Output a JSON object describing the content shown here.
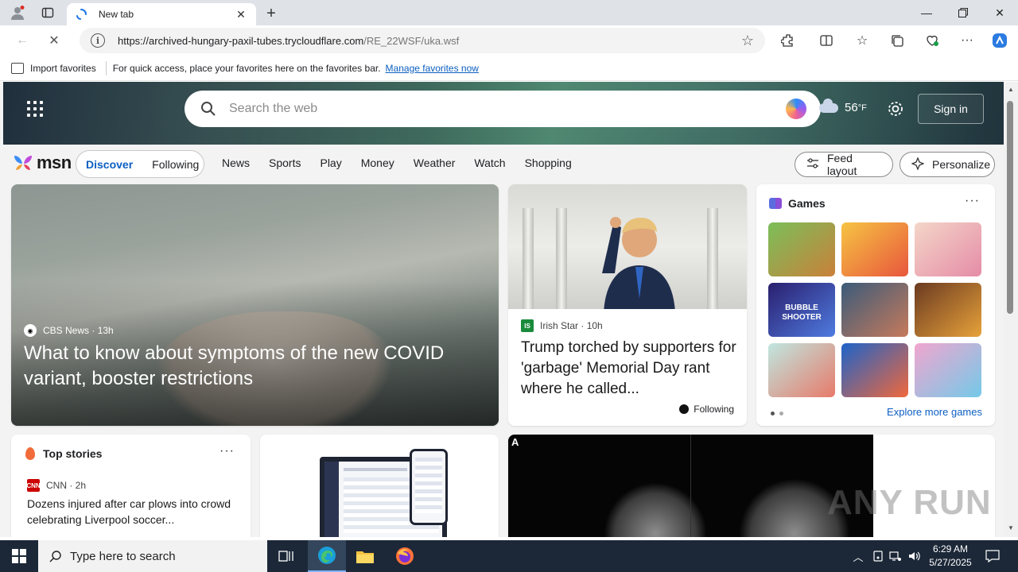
{
  "browser": {
    "tab_title": "New tab",
    "url_main": "https://archived-hungary-paxil-tubes.trycloudflare.com",
    "url_path": "/RE_22WSF/uka.wsf",
    "favorites_import": "Import favorites",
    "favorites_hint": "For quick access, place your favorites here on the favorites bar.",
    "favorites_manage": "Manage favorites now"
  },
  "msn": {
    "search_placeholder": "Search the web",
    "temperature": "56",
    "temp_unit": "°F",
    "sign_in": "Sign in",
    "brand": "msn",
    "feed_tabs": [
      "Discover",
      "Following"
    ],
    "nav": [
      "News",
      "Sports",
      "Play",
      "Money",
      "Weather",
      "Watch",
      "Shopping"
    ],
    "feed_layout": "Feed layout",
    "personalize": "Personalize"
  },
  "cards": {
    "main": {
      "source": "CBS News",
      "age": "13h",
      "headline": "What to know about symptoms of the new COVID variant, booster restrictions"
    },
    "second": {
      "source": "Irish Star",
      "age": "10h",
      "headline": "Trump torched by supporters for 'garbage' Memorial Day rant where he called...",
      "follow_label": "Following"
    },
    "games": {
      "title": "Games",
      "explore": "Explore more games",
      "tiles": [
        {
          "name": "pin-puzzle-game",
          "c1": "#7bbf5a",
          "c2": "#c9803a"
        },
        {
          "name": "cupcake-game",
          "c1": "#f6c443",
          "c2": "#e8563c"
        },
        {
          "name": "dress-up-game",
          "c1": "#f4d6c8",
          "c2": "#e58ca7"
        },
        {
          "name": "bubble-shooter-game",
          "c1": "#2a1f6e",
          "c2": "#4f7be0"
        },
        {
          "name": "story-girl-game",
          "c1": "#3b5b7a",
          "c2": "#c67a5b"
        },
        {
          "name": "adventure-girl-game",
          "c1": "#6b3a21",
          "c2": "#e7a23a"
        },
        {
          "name": "hospital-game",
          "c1": "#bfe7e0",
          "c2": "#e77a6a"
        },
        {
          "name": "shark-game",
          "c1": "#1d63c9",
          "c2": "#f0683c"
        },
        {
          "name": "fashion-game",
          "c1": "#f1a6cf",
          "c2": "#74c9e8"
        }
      ],
      "bubble_text": "BUBBLE SHOOTER"
    },
    "top_stories": {
      "title": "Top stories",
      "source": "CNN",
      "age": "2h",
      "headline": "Dozens injured after car plows into crowd celebrating Liverpool soccer..."
    },
    "scan_label": "A"
  },
  "watermark": "ANY RUN",
  "taskbar": {
    "search_placeholder": "Type here to search",
    "time": "6:29 AM",
    "date": "5/27/2025"
  },
  "colors": {
    "accent": "#0c5fc2",
    "taskbar": "#1c2838"
  }
}
